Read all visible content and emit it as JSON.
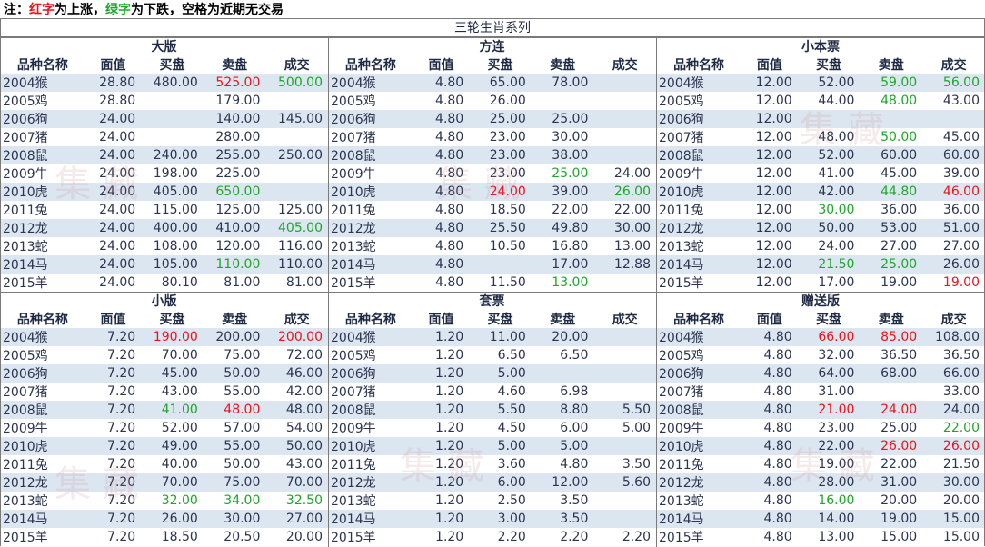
{
  "note": {
    "prefix": "注：",
    "red_word": "红字",
    "mid": "为上涨，",
    "green_word": "绿字",
    "suffix": "为下跌，空格为近期无交易"
  },
  "title": "三轮生肖系列",
  "columns": [
    "品种名称",
    "面值",
    "买盘",
    "卖盘",
    "成交"
  ],
  "watermark": "集 藏",
  "colors": {
    "up": "#e8141b",
    "down": "#1fa62a",
    "stripe": "#dce6f1"
  },
  "sections": [
    {
      "title": "大版",
      "rows": [
        {
          "name": "2004猴",
          "face": "28.80",
          "bid": "480.00",
          "ask": "525.00",
          "deal": "500.00",
          "ask_c": "up",
          "deal_c": "down"
        },
        {
          "name": "2005鸡",
          "face": "28.80",
          "bid": "",
          "ask": "179.00",
          "deal": ""
        },
        {
          "name": "2006狗",
          "face": "24.00",
          "bid": "",
          "ask": "140.00",
          "deal": "145.00"
        },
        {
          "name": "2007猪",
          "face": "24.00",
          "bid": "",
          "ask": "280.00",
          "deal": ""
        },
        {
          "name": "2008鼠",
          "face": "24.00",
          "bid": "240.00",
          "ask": "255.00",
          "deal": "250.00"
        },
        {
          "name": "2009牛",
          "face": "24.00",
          "bid": "198.00",
          "ask": "225.00",
          "deal": ""
        },
        {
          "name": "2010虎",
          "face": "24.00",
          "bid": "405.00",
          "ask": "650.00",
          "deal": "",
          "ask_c": "down"
        },
        {
          "name": "2011兔",
          "face": "24.00",
          "bid": "115.00",
          "ask": "125.00",
          "deal": "125.00"
        },
        {
          "name": "2012龙",
          "face": "24.00",
          "bid": "400.00",
          "ask": "410.00",
          "deal": "405.00",
          "deal_c": "down"
        },
        {
          "name": "2013蛇",
          "face": "24.00",
          "bid": "108.00",
          "ask": "120.00",
          "deal": "116.00"
        },
        {
          "name": "2014马",
          "face": "24.00",
          "bid": "105.00",
          "ask": "110.00",
          "deal": "110.00",
          "ask_c": "down"
        },
        {
          "name": "2015羊",
          "face": "24.00",
          "bid": "80.10",
          "ask": "81.00",
          "deal": "81.00"
        }
      ]
    },
    {
      "title": "方连",
      "rows": [
        {
          "name": "2004猴",
          "face": "4.80",
          "bid": "65.00",
          "ask": "78.00",
          "deal": ""
        },
        {
          "name": "2005鸡",
          "face": "4.80",
          "bid": "26.00",
          "ask": "",
          "deal": ""
        },
        {
          "name": "2006狗",
          "face": "4.80",
          "bid": "25.00",
          "ask": "25.00",
          "deal": ""
        },
        {
          "name": "2007猪",
          "face": "4.80",
          "bid": "23.00",
          "ask": "30.00",
          "deal": ""
        },
        {
          "name": "2008鼠",
          "face": "4.80",
          "bid": "23.00",
          "ask": "38.00",
          "deal": ""
        },
        {
          "name": "2009牛",
          "face": "4.80",
          "bid": "23.00",
          "ask": "25.00",
          "deal": "24.00",
          "ask_c": "down"
        },
        {
          "name": "2010虎",
          "face": "4.80",
          "bid": "24.00",
          "ask": "39.00",
          "deal": "26.00",
          "bid_c": "up",
          "deal_c": "down"
        },
        {
          "name": "2011兔",
          "face": "4.80",
          "bid": "18.50",
          "ask": "22.00",
          "deal": "22.00"
        },
        {
          "name": "2012龙",
          "face": "4.80",
          "bid": "25.50",
          "ask": "49.80",
          "deal": "30.00"
        },
        {
          "name": "2013蛇",
          "face": "4.80",
          "bid": "10.50",
          "ask": "16.80",
          "deal": "13.00"
        },
        {
          "name": "2014马",
          "face": "4.80",
          "bid": "",
          "ask": "17.00",
          "deal": "12.88"
        },
        {
          "name": "2015羊",
          "face": "4.80",
          "bid": "11.50",
          "ask": "13.00",
          "deal": "",
          "ask_c": "down"
        }
      ]
    },
    {
      "title": "小本票",
      "rows": [
        {
          "name": "2004猴",
          "face": "12.00",
          "bid": "52.00",
          "ask": "59.00",
          "deal": "56.00",
          "ask_c": "down",
          "deal_c": "down"
        },
        {
          "name": "2005鸡",
          "face": "12.00",
          "bid": "44.00",
          "ask": "48.00",
          "deal": "43.00",
          "ask_c": "down"
        },
        {
          "name": "2006狗",
          "face": "12.00",
          "bid": "",
          "ask": "",
          "deal": ""
        },
        {
          "name": "2007猪",
          "face": "12.00",
          "bid": "48.00",
          "ask": "50.00",
          "deal": "45.00",
          "ask_c": "down"
        },
        {
          "name": "2008鼠",
          "face": "12.00",
          "bid": "52.00",
          "ask": "60.00",
          "deal": "60.00"
        },
        {
          "name": "2009牛",
          "face": "12.00",
          "bid": "41.00",
          "ask": "45.00",
          "deal": "39.00"
        },
        {
          "name": "2010虎",
          "face": "12.00",
          "bid": "42.00",
          "ask": "44.80",
          "deal": "46.00",
          "ask_c": "down",
          "deal_c": "up"
        },
        {
          "name": "2011兔",
          "face": "12.00",
          "bid": "30.00",
          "ask": "36.00",
          "deal": "36.00",
          "bid_c": "down"
        },
        {
          "name": "2012龙",
          "face": "12.00",
          "bid": "50.00",
          "ask": "53.00",
          "deal": "51.00"
        },
        {
          "name": "2013蛇",
          "face": "12.00",
          "bid": "24.00",
          "ask": "27.00",
          "deal": "27.00"
        },
        {
          "name": "2014马",
          "face": "12.00",
          "bid": "21.50",
          "ask": "25.00",
          "deal": "26.00",
          "bid_c": "down",
          "ask_c": "down"
        },
        {
          "name": "2015羊",
          "face": "12.00",
          "bid": "17.00",
          "ask": "19.00",
          "deal": "19.00",
          "deal_c": "up"
        }
      ]
    },
    {
      "title": "小版",
      "rows": [
        {
          "name": "2004猴",
          "face": "7.20",
          "bid": "190.00",
          "ask": "200.00",
          "deal": "200.00",
          "bid_c": "up",
          "deal_c": "up"
        },
        {
          "name": "2005鸡",
          "face": "7.20",
          "bid": "70.00",
          "ask": "75.00",
          "deal": "72.00"
        },
        {
          "name": "2006狗",
          "face": "7.20",
          "bid": "45.00",
          "ask": "50.00",
          "deal": "46.00"
        },
        {
          "name": "2007猪",
          "face": "7.20",
          "bid": "43.00",
          "ask": "55.00",
          "deal": "42.00"
        },
        {
          "name": "2008鼠",
          "face": "7.20",
          "bid": "41.00",
          "ask": "48.00",
          "deal": "48.00",
          "bid_c": "down",
          "ask_c": "up"
        },
        {
          "name": "2009牛",
          "face": "7.20",
          "bid": "52.00",
          "ask": "57.00",
          "deal": "54.00"
        },
        {
          "name": "2010虎",
          "face": "7.20",
          "bid": "49.00",
          "ask": "55.00",
          "deal": "50.00"
        },
        {
          "name": "2011兔",
          "face": "7.20",
          "bid": "40.00",
          "ask": "50.00",
          "deal": "43.00"
        },
        {
          "name": "2012龙",
          "face": "7.20",
          "bid": "70.00",
          "ask": "75.00",
          "deal": "70.00"
        },
        {
          "name": "2013蛇",
          "face": "7.20",
          "bid": "32.00",
          "ask": "34.00",
          "deal": "32.50",
          "bid_c": "down",
          "ask_c": "down",
          "deal_c": "down"
        },
        {
          "name": "2014马",
          "face": "7.20",
          "bid": "26.00",
          "ask": "30.00",
          "deal": "27.00"
        },
        {
          "name": "2015羊",
          "face": "7.20",
          "bid": "18.50",
          "ask": "20.50",
          "deal": "20.00"
        }
      ]
    },
    {
      "title": "套票",
      "rows": [
        {
          "name": "2004猴",
          "face": "1.20",
          "bid": "11.00",
          "ask": "20.00",
          "deal": ""
        },
        {
          "name": "2005鸡",
          "face": "1.20",
          "bid": "6.50",
          "ask": "6.50",
          "deal": ""
        },
        {
          "name": "2006狗",
          "face": "1.20",
          "bid": "5.00",
          "ask": "",
          "deal": ""
        },
        {
          "name": "2007猪",
          "face": "1.20",
          "bid": "4.60",
          "ask": "6.98",
          "deal": ""
        },
        {
          "name": "2008鼠",
          "face": "1.20",
          "bid": "5.50",
          "ask": "8.80",
          "deal": "5.50"
        },
        {
          "name": "2009牛",
          "face": "1.20",
          "bid": "4.50",
          "ask": "6.00",
          "deal": "5.00"
        },
        {
          "name": "2010虎",
          "face": "1.20",
          "bid": "5.00",
          "ask": "5.00",
          "deal": ""
        },
        {
          "name": "2011兔",
          "face": "1.20",
          "bid": "3.60",
          "ask": "4.80",
          "deal": "3.50"
        },
        {
          "name": "2012龙",
          "face": "1.20",
          "bid": "6.00",
          "ask": "12.00",
          "deal": "5.60"
        },
        {
          "name": "2013蛇",
          "face": "1.20",
          "bid": "2.50",
          "ask": "3.50",
          "deal": ""
        },
        {
          "name": "2014马",
          "face": "1.20",
          "bid": "3.00",
          "ask": "3.50",
          "deal": ""
        },
        {
          "name": "2015羊",
          "face": "1.20",
          "bid": "2.20",
          "ask": "2.20",
          "deal": "2.20"
        }
      ]
    },
    {
      "title": "赠送版",
      "rows": [
        {
          "name": "2004猴",
          "face": "4.80",
          "bid": "66.00",
          "ask": "85.00",
          "deal": "108.00",
          "bid_c": "up",
          "ask_c": "up"
        },
        {
          "name": "2005鸡",
          "face": "4.80",
          "bid": "32.00",
          "ask": "36.50",
          "deal": "36.50"
        },
        {
          "name": "2006狗",
          "face": "4.80",
          "bid": "64.00",
          "ask": "68.00",
          "deal": "66.00"
        },
        {
          "name": "2007猪",
          "face": "4.80",
          "bid": "31.00",
          "ask": "",
          "deal": "33.00"
        },
        {
          "name": "2008鼠",
          "face": "4.80",
          "bid": "21.00",
          "ask": "24.00",
          "deal": "24.00",
          "bid_c": "up",
          "ask_c": "up"
        },
        {
          "name": "2009牛",
          "face": "4.80",
          "bid": "23.00",
          "ask": "25.00",
          "deal": "22.00",
          "deal_c": "down"
        },
        {
          "name": "2010虎",
          "face": "4.80",
          "bid": "22.00",
          "ask": "26.00",
          "deal": "26.00",
          "ask_c": "up",
          "deal_c": "up"
        },
        {
          "name": "2011兔",
          "face": "4.80",
          "bid": "19.00",
          "ask": "22.00",
          "deal": "21.50"
        },
        {
          "name": "2012龙",
          "face": "4.80",
          "bid": "28.00",
          "ask": "31.00",
          "deal": "30.00"
        },
        {
          "name": "2013蛇",
          "face": "4.80",
          "bid": "16.00",
          "ask": "20.00",
          "deal": "20.00",
          "bid_c": "down"
        },
        {
          "name": "2014马",
          "face": "4.80",
          "bid": "14.00",
          "ask": "19.00",
          "deal": "15.00"
        },
        {
          "name": "2015羊",
          "face": "4.80",
          "bid": "13.00",
          "ask": "15.00",
          "deal": "15.00"
        }
      ]
    }
  ]
}
